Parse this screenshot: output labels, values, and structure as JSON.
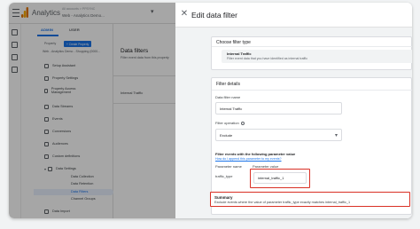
{
  "app": {
    "title": "Analytics",
    "account_line": "All accounts > PPSYNC",
    "property_line": "Web - Analytics Demo..."
  },
  "admin": {
    "tabs": [
      "ADMIN",
      "USER"
    ],
    "property_label": "Property",
    "create_property": "+ Create Property",
    "property_name": "Web - Analytics Demo - Shopping (0000...",
    "nav_items": [
      {
        "label": "Setup Assistant"
      },
      {
        "label": "Property Settings"
      },
      {
        "label": "Property Access Management"
      },
      {
        "label": "Data Streams"
      },
      {
        "label": "Events"
      },
      {
        "label": "Conversions"
      },
      {
        "label": "Audiences"
      },
      {
        "label": "Custom definitions"
      },
      {
        "label": "Data Settings"
      },
      {
        "label": "Data Import"
      }
    ],
    "data_settings_sub": [
      {
        "label": "Data Collection"
      },
      {
        "label": "Data Retention"
      },
      {
        "label": "Data Filters"
      },
      {
        "label": "Channel Groups"
      }
    ]
  },
  "main": {
    "title": "Data filters",
    "subtitle": "Filter event data from this property",
    "row_name": "Internal Traffic"
  },
  "sheet": {
    "title": "Edit data filter",
    "filter_type_heading": "Choose filter type",
    "filter_type_name": "Internal Traffic",
    "filter_type_desc": "Filter event data that you have identified as internal traffic",
    "details_heading": "Filter details",
    "filter_name_label": "Data filter name",
    "filter_name_value": "Internal Traffic",
    "filter_operation_label": "Filter operation",
    "filter_operation_value": "Exclude",
    "param_heading": "Filter events with the following parameter value",
    "param_help_link": "How do I append this parameter to my events?",
    "param_name_label": "Parameter name",
    "param_value_label": "Parameter value",
    "param_name_value": "traffic_type",
    "param_value_value": "internal_traffic_1",
    "summary_heading": "Summary",
    "summary_text": "Exclude events where the value of parameter traffic_type exactly matches internal_traffic_1"
  },
  "colors": {
    "accent": "#1a73e8",
    "highlight": "#d93025"
  }
}
